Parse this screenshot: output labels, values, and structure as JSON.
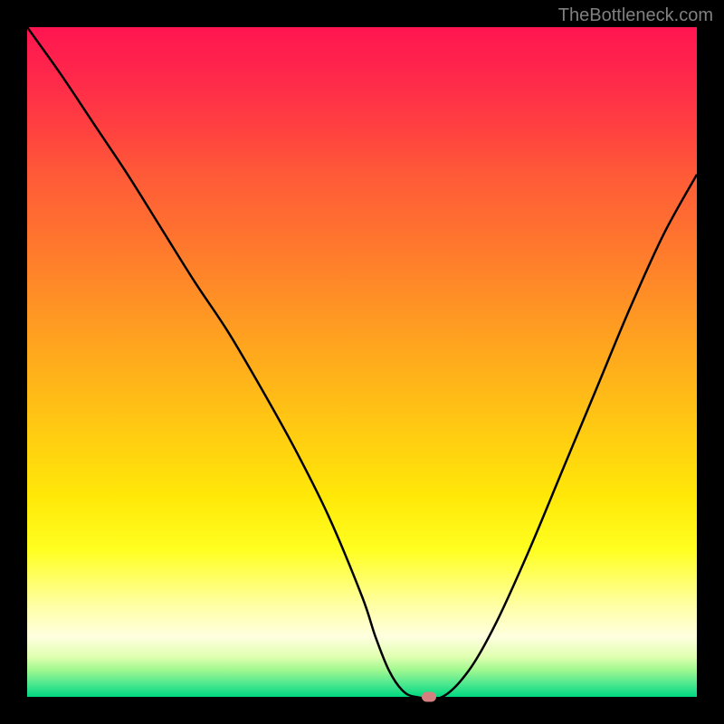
{
  "watermark": "TheBottleneck.com",
  "chart_data": {
    "type": "line",
    "title": "",
    "xlabel": "",
    "ylabel": "",
    "xlim": [
      0,
      100
    ],
    "ylim": [
      0,
      100
    ],
    "x": [
      0,
      5,
      10,
      15,
      20,
      25,
      30,
      35,
      40,
      45,
      50,
      52,
      54,
      56,
      58,
      62,
      66,
      70,
      75,
      80,
      85,
      90,
      95,
      100
    ],
    "values": [
      100,
      93,
      85.5,
      78,
      70,
      62,
      54.5,
      46,
      37,
      27,
      15,
      9,
      4,
      1,
      0,
      0,
      4,
      11,
      22,
      34,
      46,
      58,
      69,
      78
    ],
    "marker": {
      "x": 60,
      "y": 0
    },
    "background_gradient": {
      "direction": "vertical",
      "stops": [
        {
          "pos": 0,
          "color": "#ff1550"
        },
        {
          "pos": 50,
          "color": "#ffb818"
        },
        {
          "pos": 80,
          "color": "#ffff60"
        },
        {
          "pos": 100,
          "color": "#00d880"
        }
      ]
    }
  }
}
